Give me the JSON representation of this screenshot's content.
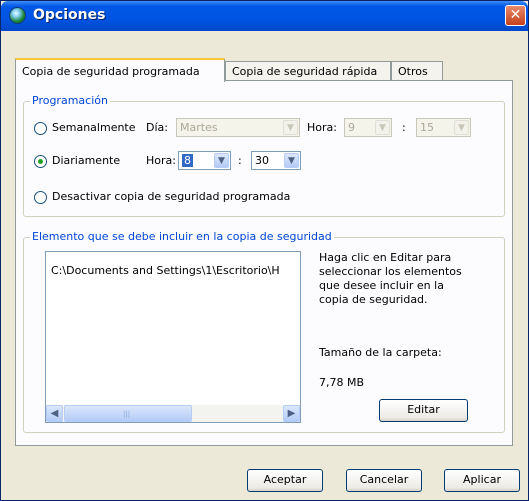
{
  "window": {
    "title": "Opciones",
    "close_glyph": "✕"
  },
  "tabs": [
    {
      "label": "Copia de seguridad programada",
      "active": true
    },
    {
      "label": "Copia de seguridad rápida",
      "active": false
    },
    {
      "label": "Otros",
      "active": false
    }
  ],
  "schedule": {
    "legend": "Programación",
    "weekly": {
      "label": "Semanalmente",
      "checked": false,
      "day_label": "Día:",
      "day_value": "Martes",
      "hour_label": "Hora:",
      "hour_value": "9",
      "minute_value": "15",
      "separator": ":"
    },
    "daily": {
      "label": "Diariamente",
      "checked": true,
      "hour_label": "Hora:",
      "hour_value": "8",
      "minute_value": "30",
      "separator": ":"
    },
    "disable": {
      "label": "Desactivar copia de seguridad programada",
      "checked": false
    }
  },
  "include": {
    "legend": "Elemento que se debe incluir en la copia de seguridad",
    "items": [
      "C:\\Documents and Settings\\1\\Escritorio\\H"
    ],
    "help_text": "Haga clic en Editar para seleccionar los elementos que desee incluir en la copia de seguridad.",
    "folder_size_label": "Tamaño de la carpeta:",
    "folder_size_value": "7,78 MB",
    "edit_button": "Editar"
  },
  "buttons": {
    "ok": "Aceptar",
    "cancel": "Cancelar",
    "apply": "Aplicar"
  },
  "icons": {
    "dropdown": "▼",
    "scroll_left": "◀",
    "scroll_right": "▶",
    "grip": "|||"
  }
}
